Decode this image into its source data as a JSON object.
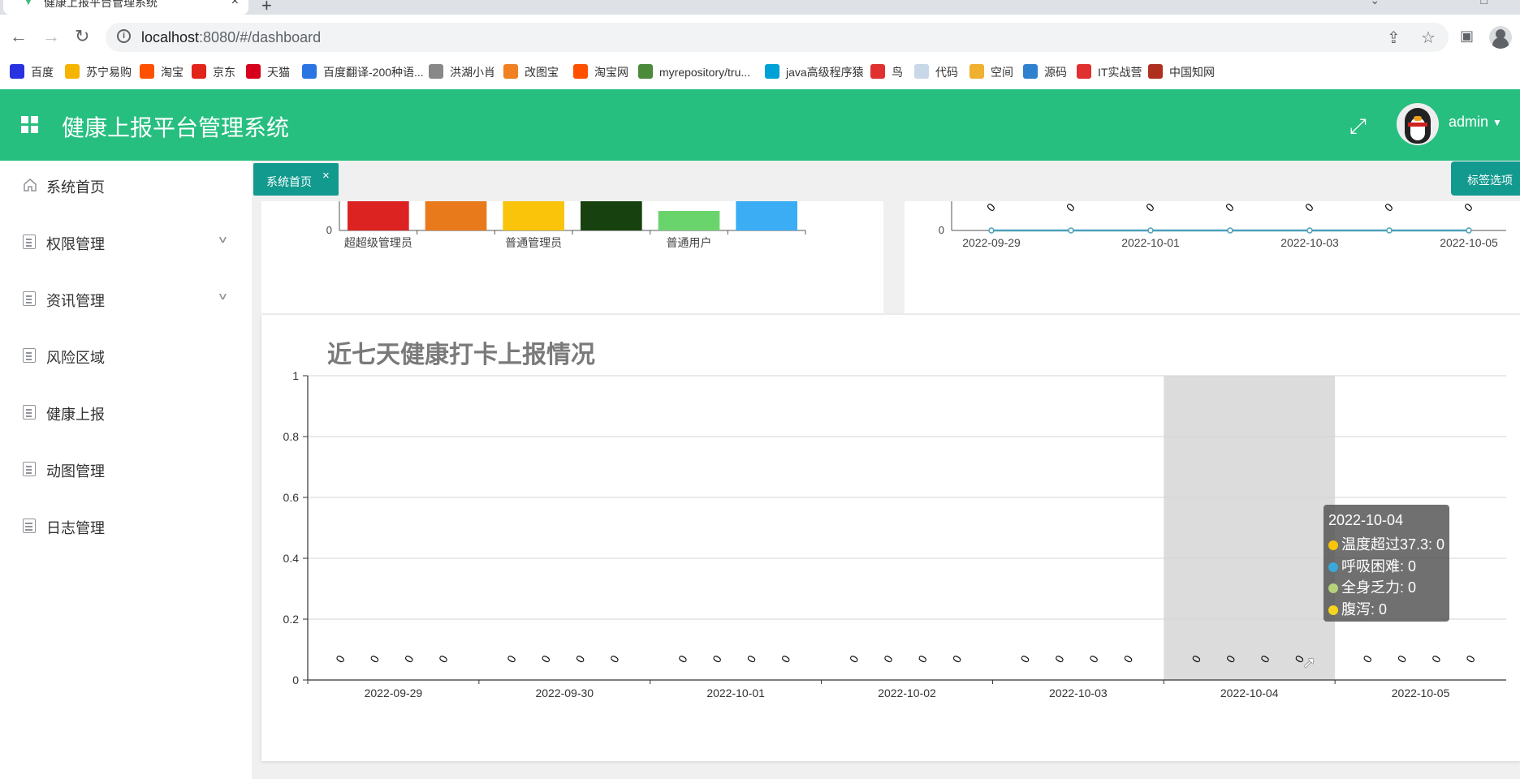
{
  "browser": {
    "tab_title": "健康上报平台管理系统",
    "tab_close": "×",
    "new_tab": "+",
    "url_host": "localhost",
    "url_rest": ":8080/#/dashboard",
    "bookmarks": [
      {
        "label": "百度",
        "color": "#2932e1"
      },
      {
        "label": "苏宁易购",
        "color": "#f5b400"
      },
      {
        "label": "淘宝",
        "color": "#ff5000"
      },
      {
        "label": "京东",
        "color": "#e1251b"
      },
      {
        "label": "天猫",
        "color": "#d6001c"
      },
      {
        "label": "百度翻译-200种语...",
        "color": "#2b74e4"
      },
      {
        "label": "洪湖小肖",
        "color": "#888888"
      },
      {
        "label": "改图宝",
        "color": "#f08020"
      },
      {
        "label": "淘宝网",
        "color": "#ff5000"
      },
      {
        "label": "myrepository/tru...",
        "color": "#4a8a3a"
      },
      {
        "label": "java高级程序猿",
        "color": "#00a1d6"
      },
      {
        "label": "鸟",
        "color": "#e03030"
      },
      {
        "label": "代码",
        "color": "#c8d8e8"
      },
      {
        "label": "空间",
        "color": "#f0b030"
      },
      {
        "label": "源码",
        "color": "#3080d0"
      },
      {
        "label": "IT实战营",
        "color": "#e03030"
      },
      {
        "label": "中国知网",
        "color": "#b03020"
      }
    ]
  },
  "app": {
    "title": "健康上报平台管理系统",
    "username": "admin",
    "brand_color": "#27bf80"
  },
  "sidebar": {
    "items": [
      {
        "label": "系统首页",
        "icon": "home-icon",
        "expandable": false
      },
      {
        "label": "权限管理",
        "icon": "document-icon",
        "expandable": true
      },
      {
        "label": "资讯管理",
        "icon": "document-icon",
        "expandable": true
      },
      {
        "label": "风险区域",
        "icon": "document-icon",
        "expandable": false
      },
      {
        "label": "健康上报",
        "icon": "document-icon",
        "expandable": false
      },
      {
        "label": "动图管理",
        "icon": "document-icon",
        "expandable": false
      },
      {
        "label": "日志管理",
        "icon": "calendar-icon",
        "expandable": false
      }
    ]
  },
  "tags": {
    "active_tag": "系统首页",
    "close": "×",
    "options_label": "标签选项"
  },
  "chart_data": [
    {
      "type": "bar",
      "categories": [
        "超超级管理员",
        "",
        "普通管理员",
        "",
        "普通用户",
        ""
      ],
      "bar_colors": [
        "#dd2222",
        "#e87a1b",
        "#f9c40a",
        "#17410f",
        "#6ad46c",
        "#3aadf5"
      ],
      "y_tick_visible": "0",
      "partially_scrolled": true
    },
    {
      "type": "line",
      "x": [
        "2022-09-29",
        "2022-09-30",
        "2022-10-01",
        "2022-10-02",
        "2022-10-03",
        "2022-10-04",
        "2022-10-05"
      ],
      "x_tick_labels": [
        "2022-09-29",
        "2022-10-01",
        "2022-10-03",
        "2022-10-05"
      ],
      "values": [
        0,
        0,
        0,
        0,
        0,
        0,
        0
      ],
      "data_labels": [
        "0",
        "0",
        "0",
        "0",
        "0",
        "0",
        "0"
      ],
      "y_tick_visible": "0",
      "line_color": "#4c9fb8",
      "partially_scrolled": true
    },
    {
      "type": "bar",
      "title": "近七天健康打卡上报情况",
      "categories": [
        "2022-09-29",
        "2022-09-30",
        "2022-10-01",
        "2022-10-02",
        "2022-10-03",
        "2022-10-04",
        "2022-10-05"
      ],
      "series": [
        {
          "name": "温度超过37.3",
          "values": [
            0,
            0,
            0,
            0,
            0,
            0,
            0
          ],
          "color": "#f9c40a"
        },
        {
          "name": "呼吸困难",
          "values": [
            0,
            0,
            0,
            0,
            0,
            0,
            0
          ],
          "color": "#3aa8d8"
        },
        {
          "name": "全身乏力",
          "values": [
            0,
            0,
            0,
            0,
            0,
            0,
            0
          ],
          "color": "#b6d27a"
        },
        {
          "name": "腹泻",
          "values": [
            0,
            0,
            0,
            0,
            0,
            0,
            0
          ],
          "color": "#f7d51f"
        }
      ],
      "data_label": "0",
      "y_ticks": [
        "0",
        "0.2",
        "0.4",
        "0.6",
        "0.8",
        "1"
      ],
      "ylim": [
        0,
        1
      ],
      "grid": true,
      "highlighted_category": "2022-10-04",
      "tooltip": {
        "title": "2022-10-04",
        "rows": [
          {
            "text": "温度超过37.3: 0",
            "color": "#f9c40a"
          },
          {
            "text": "呼吸困难: 0",
            "color": "#3aa8d8"
          },
          {
            "text": "全身乏力: 0",
            "color": "#b6d27a"
          },
          {
            "text": "腹泻: 0",
            "color": "#f7d51f"
          }
        ]
      }
    }
  ]
}
